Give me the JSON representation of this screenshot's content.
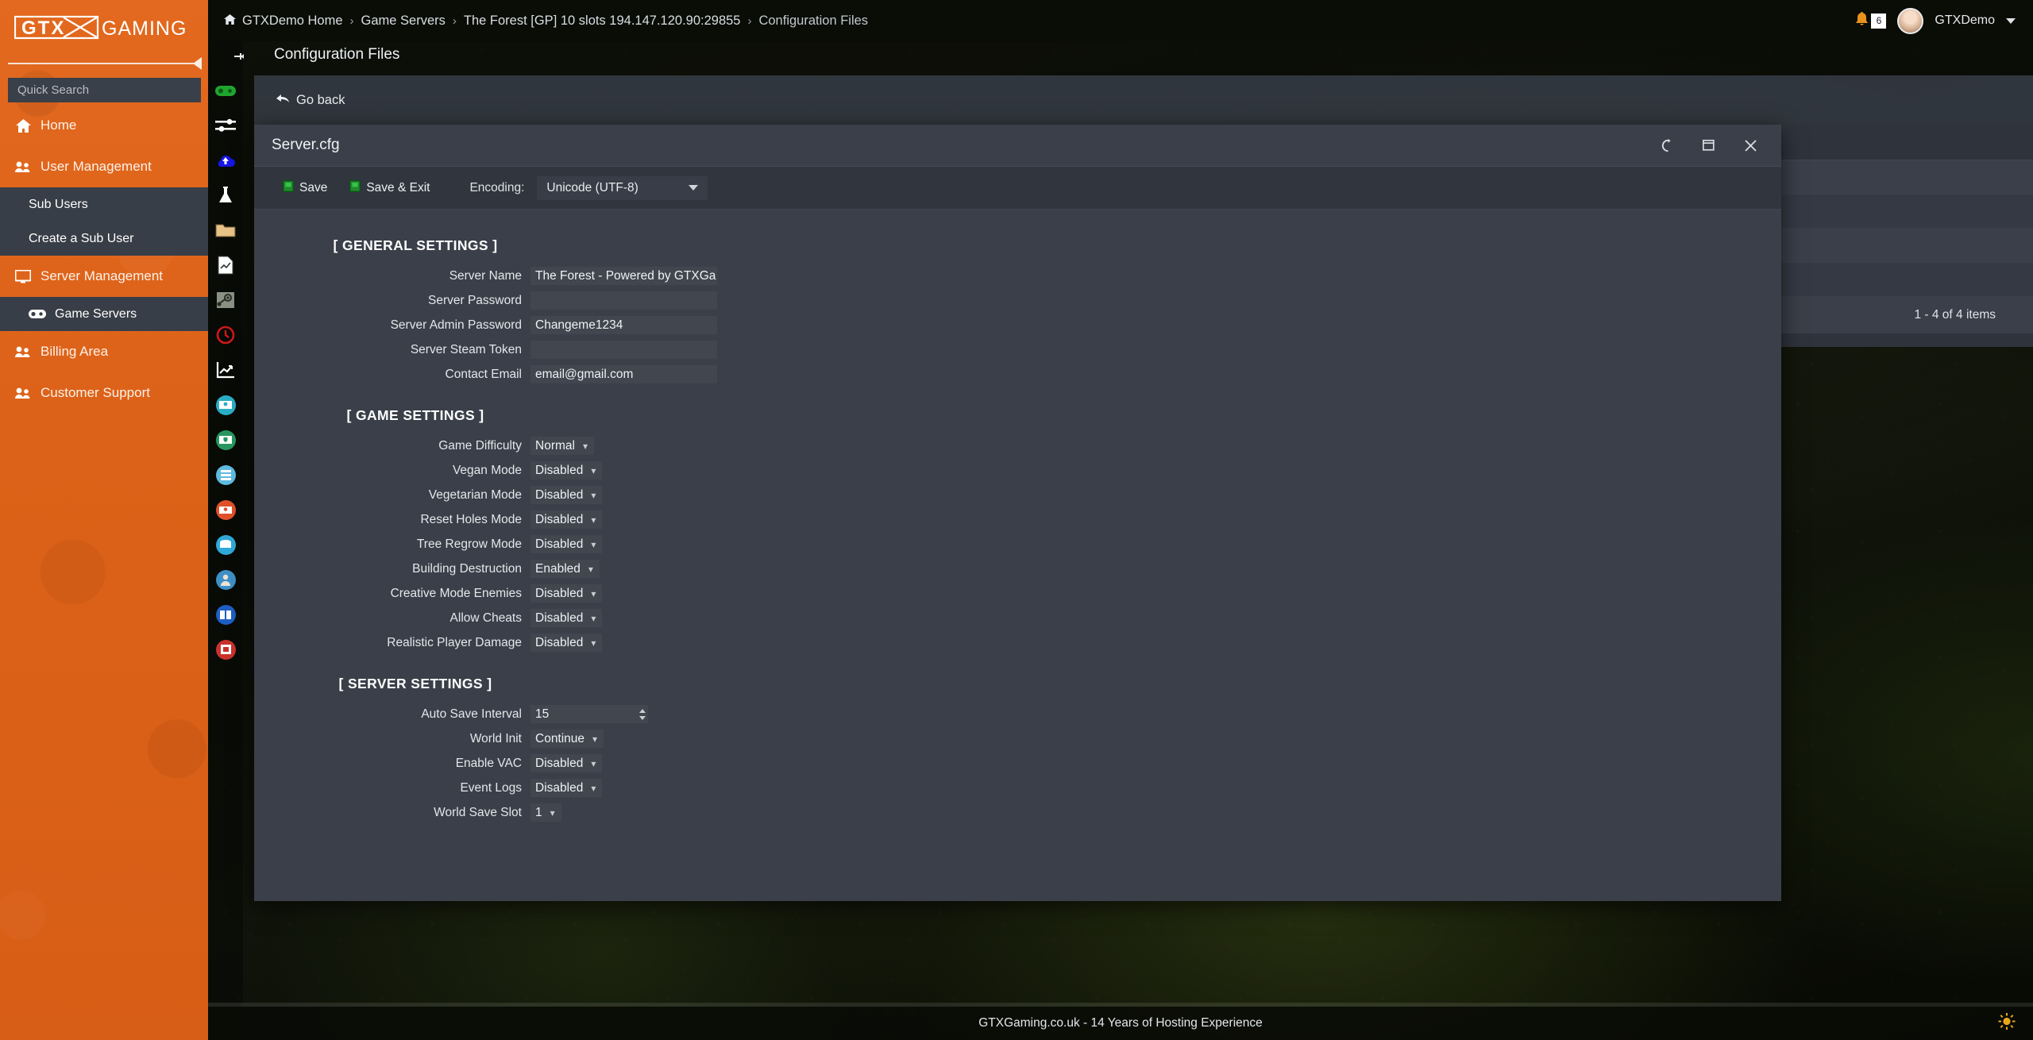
{
  "sidebar": {
    "logo_text": "GTXGaming",
    "search_placeholder": "Quick Search",
    "items": [
      {
        "label": "Home",
        "icon": "home-icon"
      },
      {
        "label": "User Management",
        "icon": "users-icon"
      },
      {
        "label": "Sub Users",
        "icon": "sub-item"
      },
      {
        "label": "Create a Sub User",
        "icon": "sub-item"
      },
      {
        "label": "Server Management",
        "icon": "monitor-icon"
      },
      {
        "label": "Game Servers",
        "icon": "gamepad-icon"
      },
      {
        "label": "Billing Area",
        "icon": "users-icon"
      },
      {
        "label": "Customer Support",
        "icon": "users-icon"
      }
    ]
  },
  "rail": {
    "pin": "pin-icon",
    "icons": [
      "gamepad-icon",
      "sliders-icon",
      "cloud-upload-icon",
      "flask-icon",
      "folder-icon",
      "file-chart-icon",
      "steam-icon",
      "clock-icon",
      "graph-icon",
      "user-monitor-icon",
      "shield-monitor-icon",
      "server-list-icon",
      "user-alert-icon",
      "database-icon",
      "person-icon",
      "book-icon",
      "archive-icon"
    ]
  },
  "topbar": {
    "breadcrumbs": [
      "GTXDemo Home",
      "Game Servers",
      "The Forest [GP] 10 slots 194.147.120.90:29855",
      "Configuration Files"
    ],
    "separator": "›",
    "notification_count": "6",
    "username": "GTXDemo"
  },
  "page": {
    "title": "Configuration Files",
    "go_back": "Go back",
    "table_footer": "1 - 4 of 4 items"
  },
  "modal": {
    "title": "Server.cfg",
    "save_label": "Save",
    "save_exit_label": "Save & Exit",
    "encoding_label": "Encoding:",
    "encoding_value": "Unicode (UTF-8)",
    "window_buttons": [
      "refresh-icon",
      "maximize-icon",
      "close-icon"
    ],
    "sections": [
      {
        "title": "[ GENERAL SETTINGS ]",
        "fields": [
          {
            "label": "Server Name",
            "type": "text",
            "value": "The Forest - Powered by GTXGa"
          },
          {
            "label": "Server Password",
            "type": "text",
            "value": ""
          },
          {
            "label": "Server Admin Password",
            "type": "text",
            "value": "Changeme1234"
          },
          {
            "label": "Server Steam Token",
            "type": "text",
            "value": ""
          },
          {
            "label": "Contact Email",
            "type": "text",
            "value": "email@gmail.com"
          }
        ]
      },
      {
        "title": "[ GAME SETTINGS ]",
        "fields": [
          {
            "label": "Game Difficulty",
            "type": "select",
            "value": "Normal"
          },
          {
            "label": "Vegan Mode",
            "type": "select",
            "value": "Disabled"
          },
          {
            "label": "Vegetarian Mode",
            "type": "select",
            "value": "Disabled"
          },
          {
            "label": "Reset Holes Mode",
            "type": "select",
            "value": "Disabled"
          },
          {
            "label": "Tree Regrow Mode",
            "type": "select",
            "value": "Disabled"
          },
          {
            "label": "Building Destruction",
            "type": "select",
            "value": "Enabled"
          },
          {
            "label": "Creative Mode Enemies",
            "type": "select",
            "value": "Disabled"
          },
          {
            "label": "Allow Cheats",
            "type": "select",
            "value": "Disabled"
          },
          {
            "label": "Realistic Player Damage",
            "type": "select",
            "value": "Disabled"
          }
        ]
      },
      {
        "title": "[ SERVER SETTINGS ]",
        "fields": [
          {
            "label": "Auto Save Interval",
            "type": "number",
            "value": "15"
          },
          {
            "label": "World Init",
            "type": "select",
            "value": "Continue"
          },
          {
            "label": "Enable VAC",
            "type": "select",
            "value": "Disabled"
          },
          {
            "label": "Event Logs",
            "type": "select",
            "value": "Disabled"
          },
          {
            "label": "World Save Slot",
            "type": "select",
            "value": "1"
          }
        ]
      }
    ]
  },
  "footer": {
    "text": "GTXGaming.co.uk - 14 Years of Hosting Experience",
    "theme_icon": "sun-icon"
  },
  "colors": {
    "brand_orange": "#dd6219",
    "panel": "#3a3f49",
    "panel_dark": "#31353e",
    "field": "#41464f",
    "accent_green": "#2faa3f"
  }
}
